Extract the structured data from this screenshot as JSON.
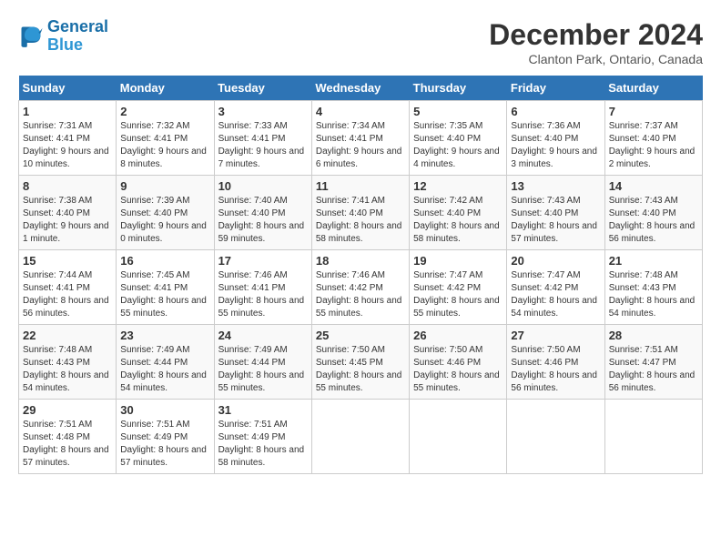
{
  "header": {
    "logo_line1": "General",
    "logo_line2": "Blue",
    "month": "December 2024",
    "location": "Clanton Park, Ontario, Canada"
  },
  "days_of_week": [
    "Sunday",
    "Monday",
    "Tuesday",
    "Wednesday",
    "Thursday",
    "Friday",
    "Saturday"
  ],
  "weeks": [
    [
      {
        "day": "1",
        "sunrise": "7:31 AM",
        "sunset": "4:41 PM",
        "daylight": "9 hours and 10 minutes."
      },
      {
        "day": "2",
        "sunrise": "7:32 AM",
        "sunset": "4:41 PM",
        "daylight": "9 hours and 8 minutes."
      },
      {
        "day": "3",
        "sunrise": "7:33 AM",
        "sunset": "4:41 PM",
        "daylight": "9 hours and 7 minutes."
      },
      {
        "day": "4",
        "sunrise": "7:34 AM",
        "sunset": "4:41 PM",
        "daylight": "9 hours and 6 minutes."
      },
      {
        "day": "5",
        "sunrise": "7:35 AM",
        "sunset": "4:40 PM",
        "daylight": "9 hours and 4 minutes."
      },
      {
        "day": "6",
        "sunrise": "7:36 AM",
        "sunset": "4:40 PM",
        "daylight": "9 hours and 3 minutes."
      },
      {
        "day": "7",
        "sunrise": "7:37 AM",
        "sunset": "4:40 PM",
        "daylight": "9 hours and 2 minutes."
      }
    ],
    [
      {
        "day": "8",
        "sunrise": "7:38 AM",
        "sunset": "4:40 PM",
        "daylight": "9 hours and 1 minute."
      },
      {
        "day": "9",
        "sunrise": "7:39 AM",
        "sunset": "4:40 PM",
        "daylight": "9 hours and 0 minutes."
      },
      {
        "day": "10",
        "sunrise": "7:40 AM",
        "sunset": "4:40 PM",
        "daylight": "8 hours and 59 minutes."
      },
      {
        "day": "11",
        "sunrise": "7:41 AM",
        "sunset": "4:40 PM",
        "daylight": "8 hours and 58 minutes."
      },
      {
        "day": "12",
        "sunrise": "7:42 AM",
        "sunset": "4:40 PM",
        "daylight": "8 hours and 58 minutes."
      },
      {
        "day": "13",
        "sunrise": "7:43 AM",
        "sunset": "4:40 PM",
        "daylight": "8 hours and 57 minutes."
      },
      {
        "day": "14",
        "sunrise": "7:43 AM",
        "sunset": "4:40 PM",
        "daylight": "8 hours and 56 minutes."
      }
    ],
    [
      {
        "day": "15",
        "sunrise": "7:44 AM",
        "sunset": "4:41 PM",
        "daylight": "8 hours and 56 minutes."
      },
      {
        "day": "16",
        "sunrise": "7:45 AM",
        "sunset": "4:41 PM",
        "daylight": "8 hours and 55 minutes."
      },
      {
        "day": "17",
        "sunrise": "7:46 AM",
        "sunset": "4:41 PM",
        "daylight": "8 hours and 55 minutes."
      },
      {
        "day": "18",
        "sunrise": "7:46 AM",
        "sunset": "4:42 PM",
        "daylight": "8 hours and 55 minutes."
      },
      {
        "day": "19",
        "sunrise": "7:47 AM",
        "sunset": "4:42 PM",
        "daylight": "8 hours and 55 minutes."
      },
      {
        "day": "20",
        "sunrise": "7:47 AM",
        "sunset": "4:42 PM",
        "daylight": "8 hours and 54 minutes."
      },
      {
        "day": "21",
        "sunrise": "7:48 AM",
        "sunset": "4:43 PM",
        "daylight": "8 hours and 54 minutes."
      }
    ],
    [
      {
        "day": "22",
        "sunrise": "7:48 AM",
        "sunset": "4:43 PM",
        "daylight": "8 hours and 54 minutes."
      },
      {
        "day": "23",
        "sunrise": "7:49 AM",
        "sunset": "4:44 PM",
        "daylight": "8 hours and 54 minutes."
      },
      {
        "day": "24",
        "sunrise": "7:49 AM",
        "sunset": "4:44 PM",
        "daylight": "8 hours and 55 minutes."
      },
      {
        "day": "25",
        "sunrise": "7:50 AM",
        "sunset": "4:45 PM",
        "daylight": "8 hours and 55 minutes."
      },
      {
        "day": "26",
        "sunrise": "7:50 AM",
        "sunset": "4:46 PM",
        "daylight": "8 hours and 55 minutes."
      },
      {
        "day": "27",
        "sunrise": "7:50 AM",
        "sunset": "4:46 PM",
        "daylight": "8 hours and 56 minutes."
      },
      {
        "day": "28",
        "sunrise": "7:51 AM",
        "sunset": "4:47 PM",
        "daylight": "8 hours and 56 minutes."
      }
    ],
    [
      {
        "day": "29",
        "sunrise": "7:51 AM",
        "sunset": "4:48 PM",
        "daylight": "8 hours and 57 minutes."
      },
      {
        "day": "30",
        "sunrise": "7:51 AM",
        "sunset": "4:49 PM",
        "daylight": "8 hours and 57 minutes."
      },
      {
        "day": "31",
        "sunrise": "7:51 AM",
        "sunset": "4:49 PM",
        "daylight": "8 hours and 58 minutes."
      },
      null,
      null,
      null,
      null
    ]
  ]
}
